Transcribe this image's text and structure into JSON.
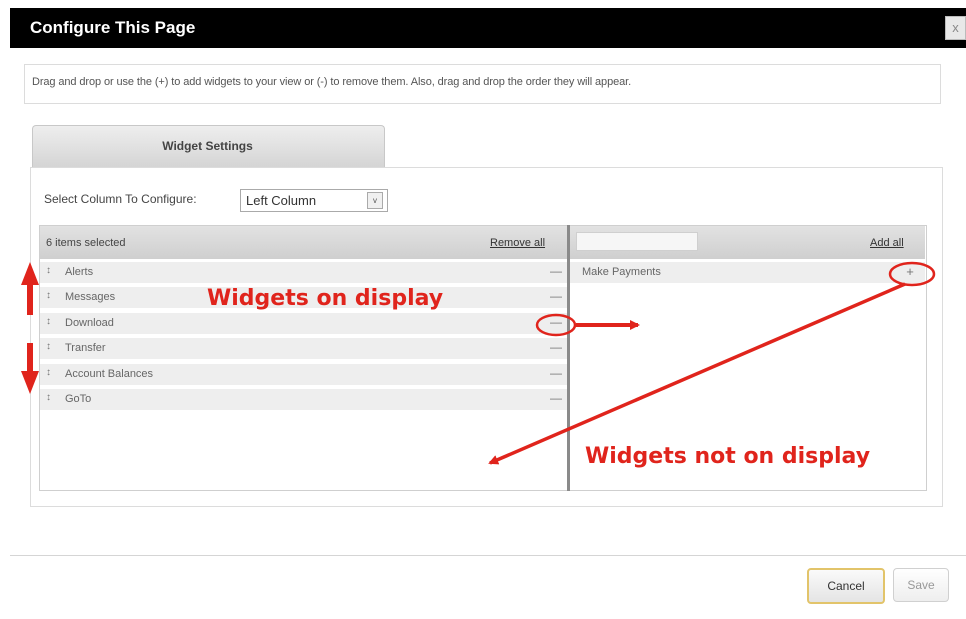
{
  "dialog": {
    "title": "Configure This Page",
    "close_label": "x"
  },
  "instruction": "Drag and drop or use the (+) to add widgets to your view or (-) to remove them. Also, drag and drop the order they will appear.",
  "tab": {
    "label": "Widget Settings"
  },
  "column_select": {
    "label": "Select Column To Configure:",
    "value": "Left Column",
    "arrow": "v"
  },
  "left_list": {
    "count_label": "6 items selected",
    "remove_all_label": "Remove all",
    "items": [
      {
        "label": "Alerts",
        "action": "—"
      },
      {
        "label": "Messages",
        "action": "—"
      },
      {
        "label": "Download",
        "action": "—"
      },
      {
        "label": "Transfer",
        "action": "—"
      },
      {
        "label": "Account Balances",
        "action": "—"
      },
      {
        "label": "GoTo",
        "action": "—"
      }
    ]
  },
  "right_list": {
    "search_value": "",
    "add_all_label": "Add all",
    "items": [
      {
        "label": "Make Payments",
        "action": "+"
      }
    ]
  },
  "annotations": {
    "on_display": "Widgets on display",
    "not_on_display": "Widgets not on display",
    "color": "#e0241c"
  },
  "footer": {
    "cancel_label": "Cancel",
    "save_label": "Save"
  },
  "icons": {
    "grip": "drag-handle-icon",
    "remove": "minus-icon",
    "add": "plus-icon"
  }
}
